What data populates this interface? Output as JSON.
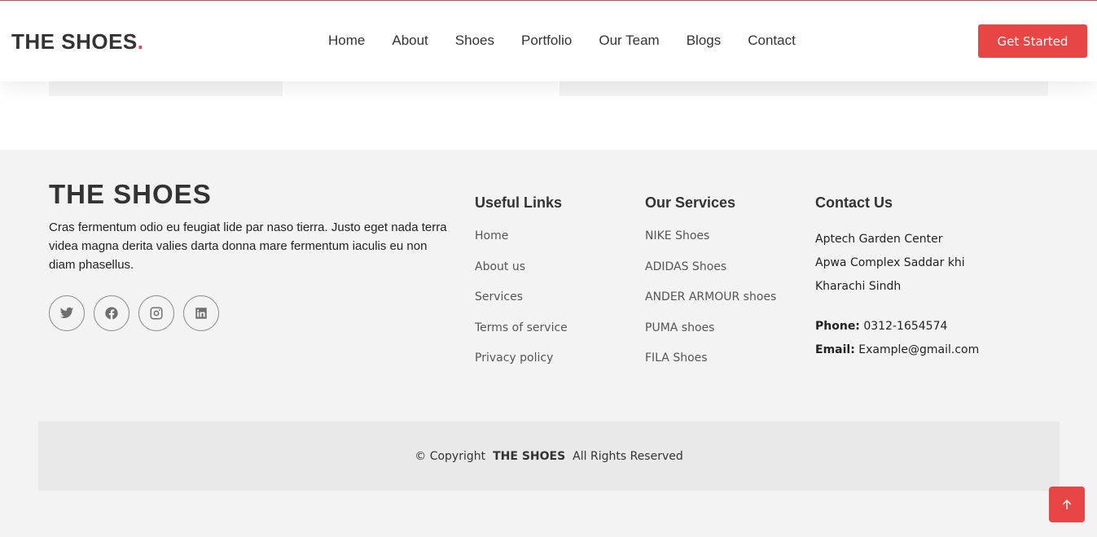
{
  "header": {
    "logo_text": "THE SHOES",
    "logo_dot": ".",
    "nav": [
      "Home",
      "About",
      "Shoes",
      "Portfolio",
      "Our Team",
      "Blogs",
      "Contact"
    ],
    "cta_label": "Get Started"
  },
  "footer": {
    "brand": "THE SHOES",
    "description": "Cras fermentum odio eu feugiat lide par naso tierra. Justo eget nada terra videa magna derita valies darta donna mare fermentum iaculis eu non diam phasellus.",
    "socials": [
      "twitter-icon",
      "facebook-icon",
      "instagram-icon",
      "linkedin-icon"
    ],
    "useful_links": {
      "title": "Useful Links",
      "items": [
        "Home",
        "About us",
        "Services",
        "Terms of service",
        "Privacy policy"
      ]
    },
    "services": {
      "title": "Our Services",
      "items": [
        "NIKE Shoes",
        "ADIDAS Shoes",
        "ANDER ARMOUR shoes",
        "PUMA shoes",
        "FILA Shoes"
      ]
    },
    "contact": {
      "title": "Contact Us",
      "address": [
        "Aptech Garden Center",
        "Apwa Complex Saddar khi",
        "Kharachi Sindh"
      ],
      "phone_label": "Phone:",
      "phone": "0312-1654574",
      "email_label": "Email:",
      "email": "Example@gmail.com"
    },
    "copyright_prefix": "© Copyright",
    "copyright_brand": "THE SHOES",
    "copyright_suffix": "All Rights Reserved"
  },
  "colors": {
    "accent": "#e84545",
    "footer_bg": "#f3f3f3",
    "copy_bg": "#e9e9e9"
  }
}
